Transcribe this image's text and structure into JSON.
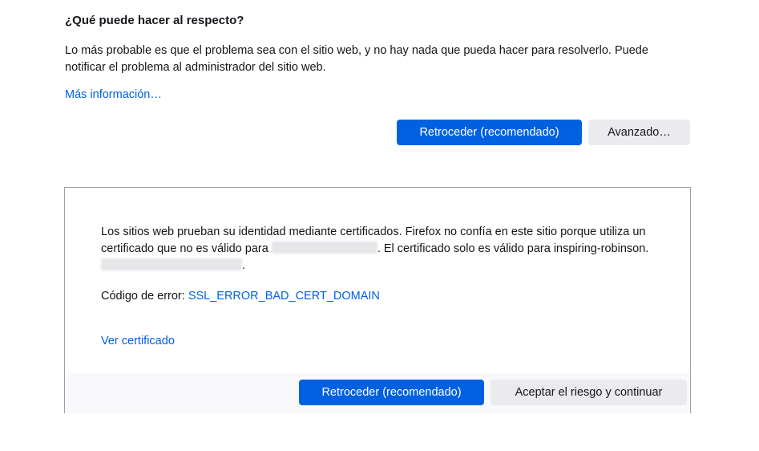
{
  "main": {
    "heading": "¿Qué puede hacer al respecto?",
    "paragraph": "Lo más probable es que el problema sea con el sitio web, y no hay nada que pueda hacer para resolverlo. Puede notificar el problema al administrador del sitio web.",
    "more_info_link": "Más información…",
    "back_button": "Retroceder (recomendado)",
    "advanced_button": "Avanzado…"
  },
  "advanced": {
    "text_part1": "Los sitios web prueban su identidad mediante certificados. Firefox no confía en este sitio porque utiliza un certificado que no es válido para ",
    "text_part2": ". El certificado solo es válido para inspiring-robinson.",
    "text_part3": ".",
    "error_label": "Código de error: ",
    "error_code": "SSL_ERROR_BAD_CERT_DOMAIN",
    "view_certificate_link": "Ver certificado",
    "back_button": "Retroceder (recomendado)",
    "accept_button": "Aceptar el riesgo y continuar"
  },
  "colors": {
    "accent": "#0061e0",
    "secondary_button": "#ebebef",
    "footer_bg": "#f9f9fb",
    "panel_border": "#9f9fa5"
  }
}
